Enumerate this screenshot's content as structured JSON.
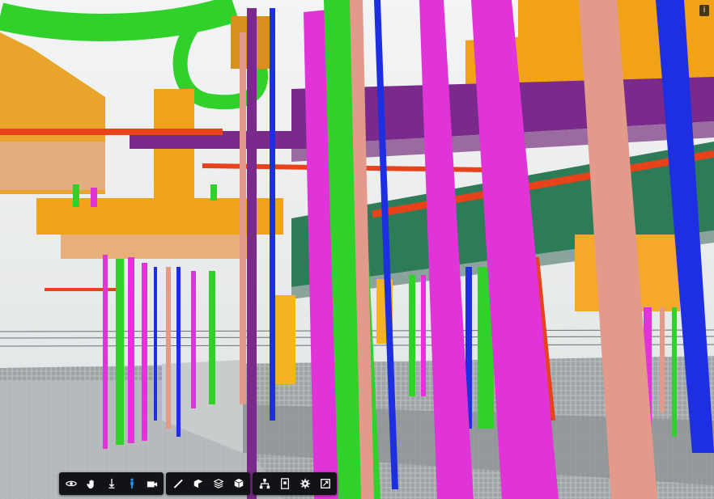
{
  "viewer": {
    "info_label": "i",
    "colors": {
      "sky": "#eef0f2",
      "floor": "#aaaeb0",
      "duct_orange": "#f0a21a",
      "duct_tan": "#e7b07a",
      "pipe_green": "#2fd12a",
      "pipe_magenta": "#e033d8",
      "pipe_blue": "#1d2fe0",
      "pipe_salmon": "#e39a8a",
      "pipe_red": "#e8421b",
      "duct_purple": "#7a2a8a",
      "tray_green": "#2e7b58",
      "toolbar_bg": "#111316",
      "active_tool": "#1e9bff"
    }
  },
  "toolbar": {
    "groups": [
      [
        {
          "name": "orbit-icon",
          "active": false
        },
        {
          "name": "pan-icon",
          "active": false
        },
        {
          "name": "zoom-icon",
          "active": false
        },
        {
          "name": "first-person-icon",
          "active": true
        },
        {
          "name": "camera-icon",
          "active": false
        }
      ],
      [
        {
          "name": "measure-icon",
          "active": false
        },
        {
          "name": "section-icon",
          "active": false
        },
        {
          "name": "explode-icon",
          "active": false
        },
        {
          "name": "model-browser-icon",
          "active": false
        }
      ],
      [
        {
          "name": "structure-icon",
          "active": false
        },
        {
          "name": "properties-icon",
          "active": false
        },
        {
          "name": "settings-icon",
          "active": false
        },
        {
          "name": "fullscreen-icon",
          "active": false
        }
      ]
    ]
  }
}
